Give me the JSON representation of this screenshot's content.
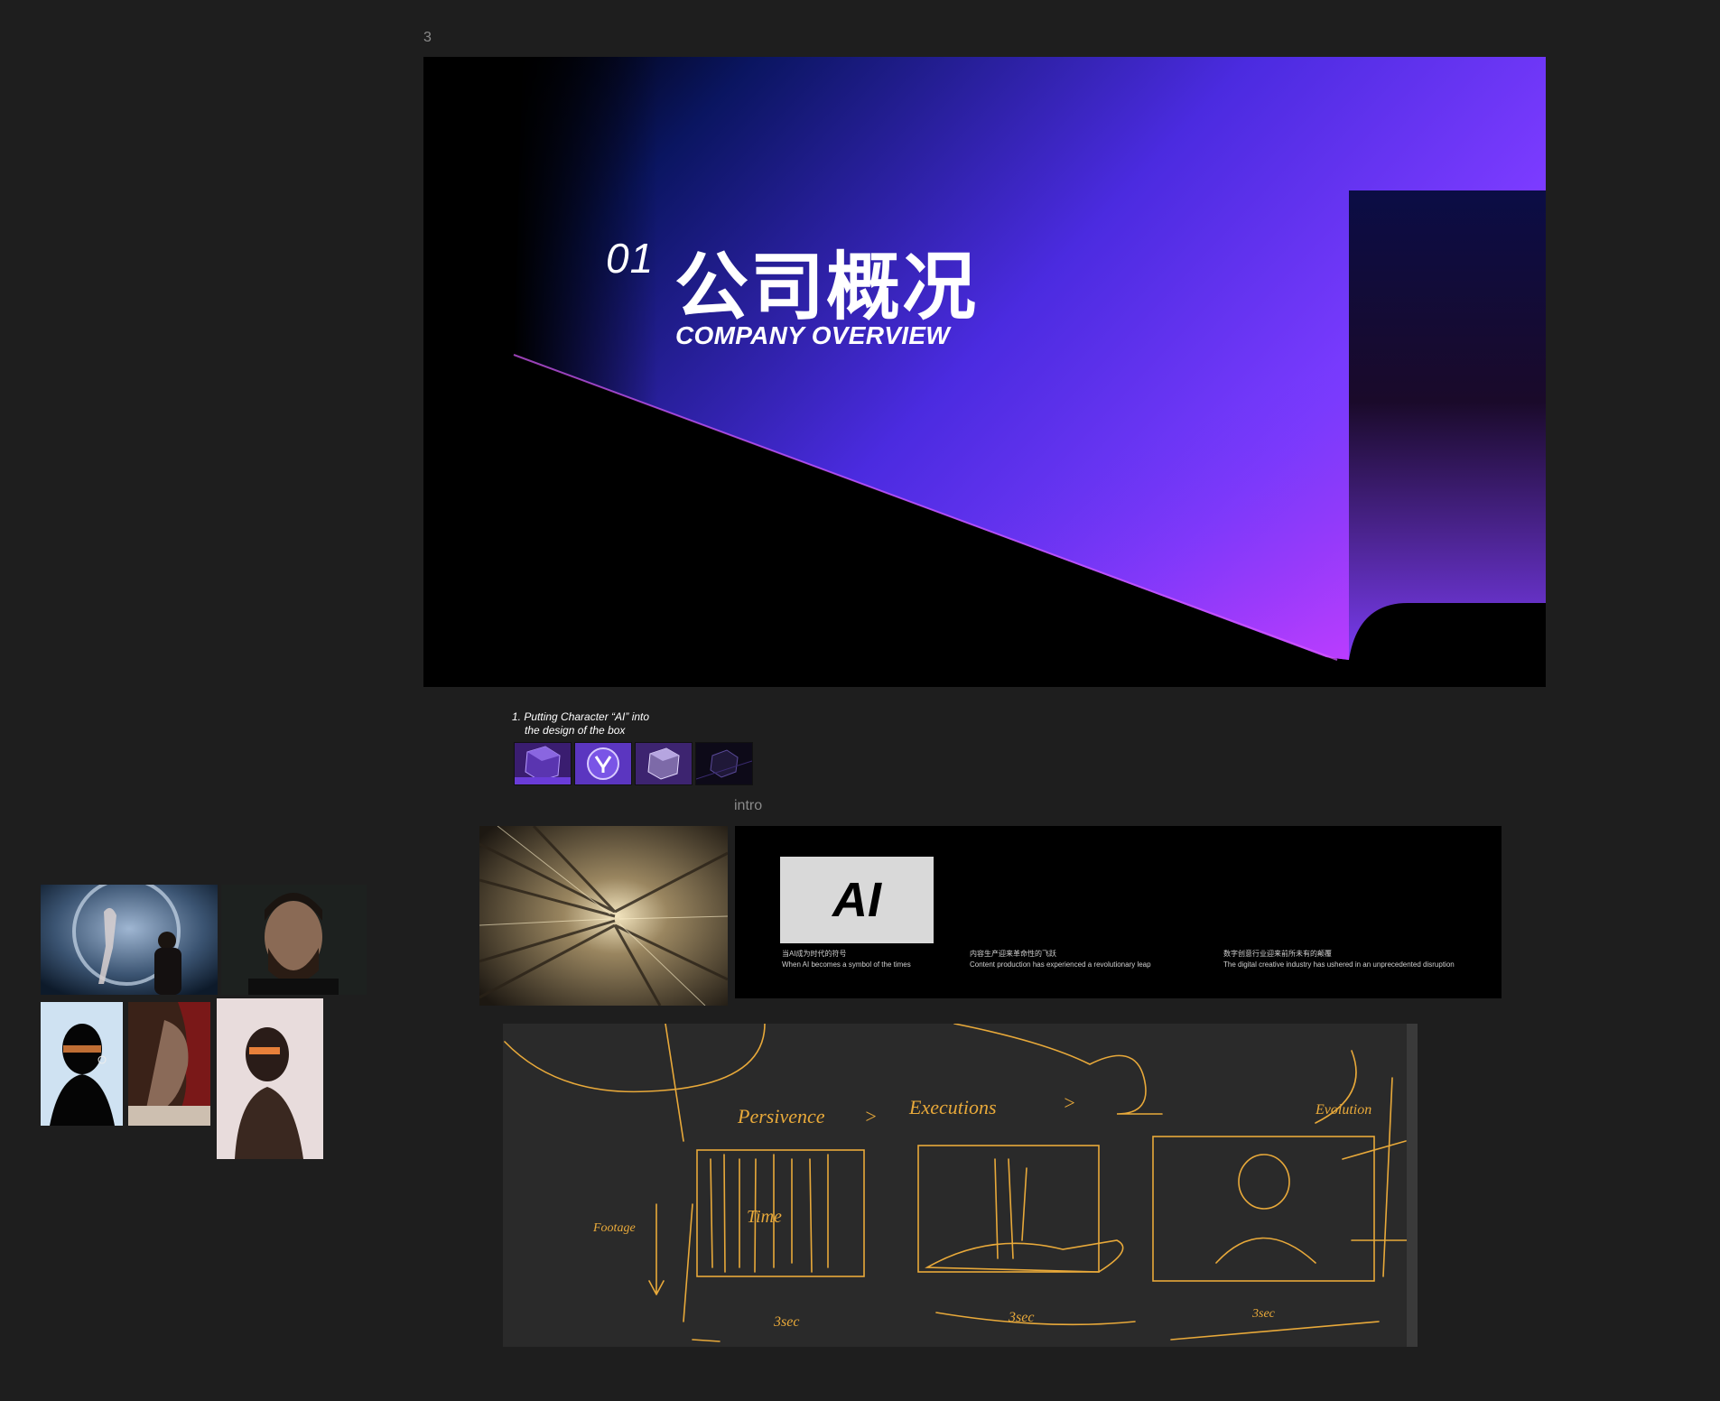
{
  "frame_label": "3",
  "slide": {
    "number": "01",
    "title_cn": "公司概况",
    "subtitle": "COMPANY OVERVIEW",
    "colors": {
      "dark_blue": "#0a1560",
      "violet": "#7b3bff",
      "magenta": "#b03cff",
      "background": "#000000"
    }
  },
  "box_note": {
    "line1": "1. Putting Character “AI” into",
    "line2": "the design of the box"
  },
  "intro_label": "intro",
  "intro_panel": {
    "ai_box_text": "AI",
    "captions": [
      {
        "cn": "当AI成为时代的符号",
        "en": "When AI becomes a symbol of the times"
      },
      {
        "cn": "内容生产迎来革命性的飞跃",
        "en": "Content production has experienced a revolutionary leap"
      },
      {
        "cn": "数字创意行业迎来前所未有的颠覆",
        "en": "The digital creative industry has ushered in an unprecedented disruption"
      }
    ]
  },
  "sketch": {
    "ink_color": "#e8a93a",
    "words": [
      "Persivence",
      ">",
      "Executions",
      ">",
      "Evolution",
      "Footage",
      "Time",
      "3sec",
      "3sec",
      "3sec"
    ]
  },
  "canvas_background": "#1e1e1e"
}
